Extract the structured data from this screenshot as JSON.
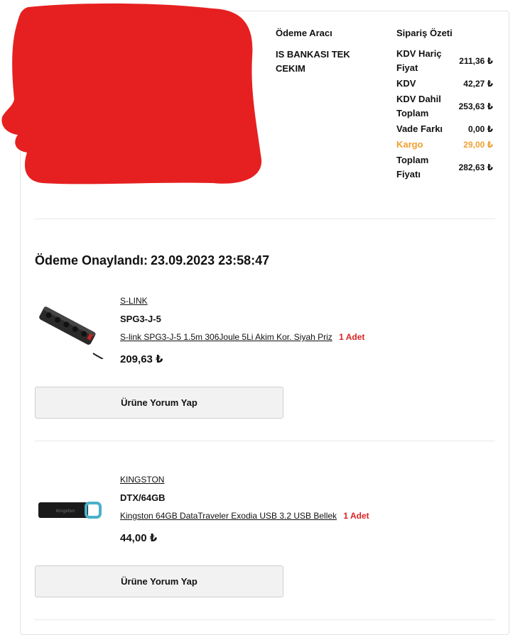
{
  "payment": {
    "title": "Ödeme Aracı",
    "method": "IS BANKASI TEK CEKIM"
  },
  "summary": {
    "title": "Sipariş Özeti",
    "rows": [
      {
        "label": "KDV Hariç Fiyat",
        "value": "211,36 ₺"
      },
      {
        "label": "KDV",
        "value": "42,27 ₺"
      },
      {
        "label": "KDV Dahil Toplam",
        "value": "253,63 ₺"
      },
      {
        "label": "Vade Farkı",
        "value": "0,00 ₺"
      },
      {
        "label": "Kargo",
        "value": "29,00 ₺"
      },
      {
        "label": "Toplam Fiyatı",
        "value": "282,63 ₺"
      }
    ]
  },
  "confirmation": {
    "label": "Ödeme Onaylandı:",
    "datetime": "23.09.2023 23:58:47"
  },
  "items": [
    {
      "brand": "S-LINK",
      "sku": "SPG3-J-5",
      "name": "S-link SPG3-J-5 1.5m 306Joule 5Li Akim Kor. Siyah Priz",
      "qty": "1 Adet",
      "price": "209,63 ₺",
      "review_label": "Ürüne Yorum Yap"
    },
    {
      "brand": "KINGSTON",
      "sku": "DTX/64GB",
      "name": "Kingston 64GB DataTraveler Exodia USB 3.2 USB Bellek",
      "qty": "1 Adet",
      "price": "44,00 ₺",
      "review_label": "Ürüne Yorum Yap"
    }
  ],
  "colors": {
    "accent_red": "#dd2222",
    "kargo_orange": "#f0a030",
    "redaction": "#e62020"
  },
  "icons": [
    "power-strip-image",
    "usb-drive-image"
  ]
}
